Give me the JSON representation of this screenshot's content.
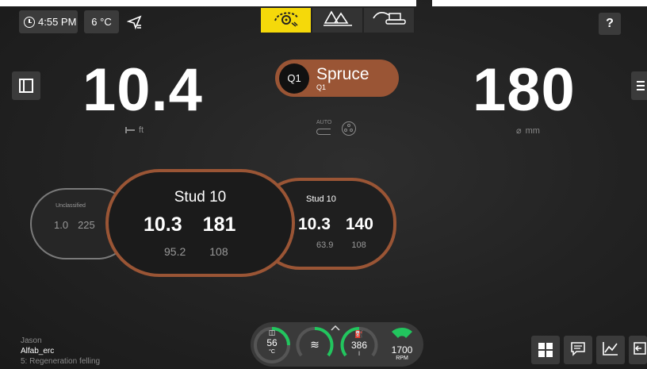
{
  "status": {
    "time": "4:55 PM",
    "temperature": "6 °C",
    "help": "?"
  },
  "modes": [
    {
      "name": "harvester-head-icon",
      "active": true
    },
    {
      "name": "forest-icon",
      "active": false
    },
    {
      "name": "machine-icon",
      "active": false
    }
  ],
  "length": {
    "value": "10.4",
    "unit": "ft"
  },
  "diameter": {
    "value": "180",
    "unit": "mm"
  },
  "species": {
    "quality": "Q1",
    "name": "Spruce",
    "sub": "Q1"
  },
  "auto_label": "AUTO",
  "cards": {
    "left": {
      "title": "Unclassified",
      "v1": "1.0",
      "v2": "225"
    },
    "center": {
      "title": "Stud 10",
      "v1": "10.3",
      "v2": "181",
      "s1": "95.2",
      "s2": "108"
    },
    "right": {
      "title": "Stud 10",
      "v1": "10.3",
      "v2": "140",
      "s1": "63.9",
      "s2": "108"
    }
  },
  "operator": {
    "name": "Jason",
    "site": "Alfab_erc",
    "program": "5: Regeneration felling"
  },
  "gauges": [
    {
      "name": "oil-temp",
      "value": "56",
      "unit": "°C",
      "level": 0.4
    },
    {
      "name": "hydraulic-level",
      "value": "",
      "unit": "",
      "level": 0.5
    },
    {
      "name": "fuel",
      "value": "386",
      "unit": "l",
      "level": 0.55
    },
    {
      "name": "rpm",
      "value": "1700",
      "unit": "RPM",
      "level": 0.6
    }
  ],
  "colors": {
    "accent_yellow": "#f5d90a",
    "brown": "#9a5535",
    "gauge_green": "#22c55e"
  }
}
